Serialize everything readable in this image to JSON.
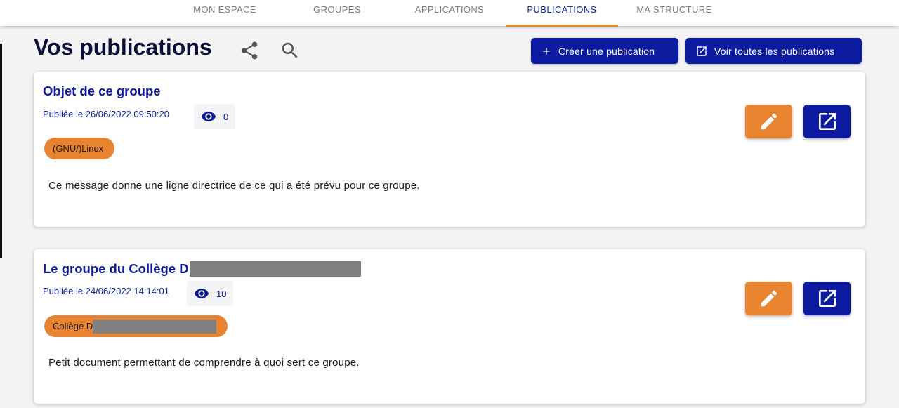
{
  "nav": {
    "tabs": [
      {
        "label": "MON ESPACE"
      },
      {
        "label": "GROUPES"
      },
      {
        "label": "APPLICATIONS"
      },
      {
        "label": "PUBLICATIONS"
      },
      {
        "label": "MA STRUCTURE"
      }
    ],
    "active_index": 3
  },
  "header": {
    "title": "Vos publications",
    "share_icon": "share-icon",
    "search_icon": "search-icon",
    "create_label": "Créer une publication",
    "view_all_label": "Voir toutes les publications"
  },
  "publications": [
    {
      "title": "Objet de ce groupe",
      "published": "Publiée le 26/06/2022 09:50:20",
      "views": "0",
      "tag": "(GNU/)Linux",
      "body": "Ce message donne une ligne directrice de ce qui a été prévu pour ce groupe."
    },
    {
      "title": "Le groupe du Collège D",
      "published": "Publiée le 24/06/2022 14:14:01",
      "views": "10",
      "tag": "Collège D",
      "body": "Petit document permettant de comprendre à quoi sert ce groupe."
    }
  ],
  "colors": {
    "accent_orange": "#e8832f",
    "primary_blue": "#0b1a9e",
    "redaction_gray": "#808080"
  }
}
